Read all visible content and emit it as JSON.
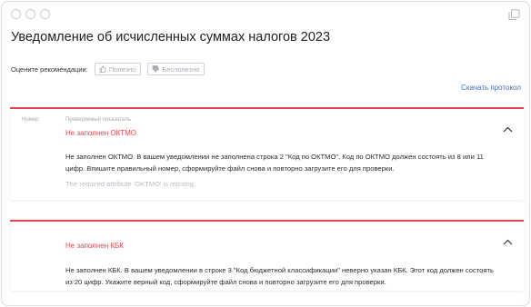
{
  "window": {
    "title": "Уведомление об исчисленных суммах налогов 2023"
  },
  "rating": {
    "label": "Оцените рекомендации:",
    "useful": "Полезно",
    "useless": "Бесполезно"
  },
  "download_protocol": "Скачать протокол",
  "columns": {
    "number": "Номер",
    "indicator": "Проверяемый показатель"
  },
  "errors": [
    {
      "title": "Не заполнен ОКТМО",
      "text": "Не заполнен ОКТМО. В вашем уведомлении не заполнена строка 2 \"Код по ОКТМО\". Код по ОКТМО должен состоять из 8 или 11 цифр. Впишите правильный номер, сформируйте файл снова и повторно загрузите его для проверки.",
      "technical": "The required attribute 'OKTMO' is missing."
    },
    {
      "title": "Не заполнен КБК",
      "text": "Не заполнен КБК. В вашем уведомлении в строке 3 \"Код бюджетной классификации\" неверно указан КБК. Этот код должен состоять из 20 цифр. Укажите верный код, сформируйте файл снова и повторно загрузите его для проверки."
    }
  ],
  "colors": {
    "accent_red": "#e2454f",
    "link_blue": "#3a6fc4",
    "muted_text": "#b9bdc3"
  }
}
